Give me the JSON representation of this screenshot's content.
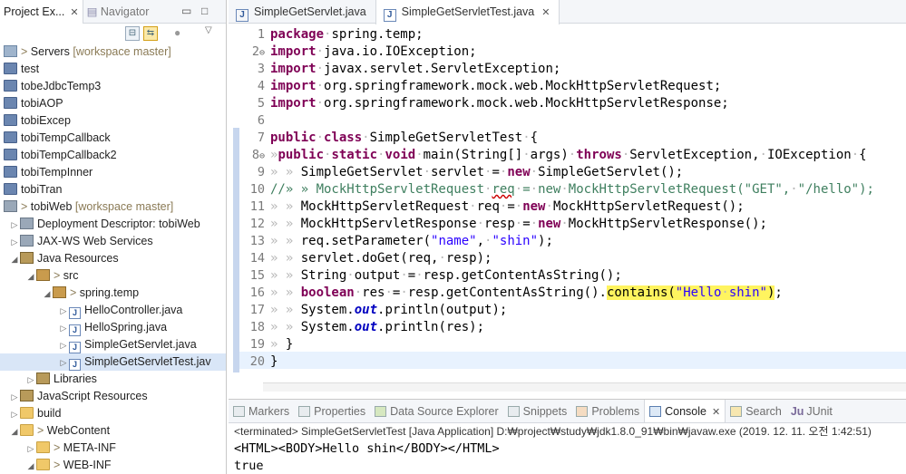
{
  "left_panel": {
    "tabs": [
      {
        "label": "Project Ex..."
      },
      {
        "label": "Navigator"
      }
    ],
    "tree": [
      {
        "label": "Servers",
        "suffix": "[workspace master]"
      },
      {
        "label": "test"
      },
      {
        "label": "tobeJdbcTemp3"
      },
      {
        "label": "tobiAOP"
      },
      {
        "label": "tobiExcep"
      },
      {
        "label": "tobiTempCallback"
      },
      {
        "label": "tobiTempCallback2"
      },
      {
        "label": "tobiTempInner"
      },
      {
        "label": "tobiTran"
      },
      {
        "label": "tobiWeb",
        "suffix": "[workspace master]"
      },
      {
        "label": "Deployment Descriptor: tobiWeb"
      },
      {
        "label": "JAX-WS Web Services"
      },
      {
        "label": "Java Resources"
      },
      {
        "label": "src"
      },
      {
        "label": "spring.temp"
      },
      {
        "label": "HelloController.java"
      },
      {
        "label": "HelloSpring.java"
      },
      {
        "label": "SimpleGetServlet.java"
      },
      {
        "label": "SimpleGetServletTest.jav"
      },
      {
        "label": "Libraries"
      },
      {
        "label": "JavaScript Resources"
      },
      {
        "label": "build"
      },
      {
        "label": "WebContent"
      },
      {
        "label": "META-INF"
      },
      {
        "label": "WEB-INF"
      }
    ]
  },
  "editor": {
    "tabs": [
      {
        "label": "SimpleGetServlet.java"
      },
      {
        "label": "SimpleGetServletTest.java"
      }
    ],
    "lines": [
      {
        "n": "1",
        "code": "package spring.temp;"
      },
      {
        "n": "2",
        "code": "import java.io.IOException;"
      },
      {
        "n": "3",
        "code": "import javax.servlet.ServletException;"
      },
      {
        "n": "4",
        "code": "import org.springframework.mock.web.MockHttpServletRequest;"
      },
      {
        "n": "5",
        "code": "import org.springframework.mock.web.MockHttpServletResponse;"
      },
      {
        "n": "6",
        "code": ""
      },
      {
        "n": "7",
        "code": "public class SimpleGetServletTest {"
      },
      {
        "n": "8",
        "code": "public static void main(String[] args) throws ServletException, IOException {"
      },
      {
        "n": "9",
        "code": "SimpleGetServlet servlet = new SimpleGetServlet();"
      },
      {
        "n": "10",
        "code": "MockHttpServletRequest req = new MockHttpServletRequest(\"GET\", \"/hello\");"
      },
      {
        "n": "11",
        "code": "MockHttpServletRequest req = new MockHttpServletRequest();"
      },
      {
        "n": "12",
        "code": "MockHttpServletResponse resp = new MockHttpServletResponse();"
      },
      {
        "n": "13",
        "code": "req.setParameter(\"name\", \"shin\");"
      },
      {
        "n": "14",
        "code": "servlet.doGet(req, resp);"
      },
      {
        "n": "15",
        "code": "String output = resp.getContentAsString();"
      },
      {
        "n": "16",
        "code": "boolean res = resp.getContentAsString().contains(\"Hello shin\");"
      },
      {
        "n": "17",
        "code": "System.out.println(output);"
      },
      {
        "n": "18",
        "code": "System.out.println(res);"
      },
      {
        "n": "19",
        "code": "}"
      },
      {
        "n": "20",
        "code": "}"
      }
    ]
  },
  "bottom_panel": {
    "tabs": [
      {
        "label": "Markers"
      },
      {
        "label": "Properties"
      },
      {
        "label": "Data Source Explorer"
      },
      {
        "label": "Snippets"
      },
      {
        "label": "Problems"
      },
      {
        "label": "Console"
      },
      {
        "label": "Search"
      },
      {
        "label": "JUnit"
      }
    ],
    "terminated": "<terminated> SimpleGetServletTest [Java Application] D:₩project₩study₩jdk1.8.0_91₩bin₩javaw.exe (2019. 12. 11. 오전 1:42:51)",
    "output": [
      "<HTML><BODY>Hello shin</BODY></HTML>",
      "true"
    ]
  },
  "colors": {
    "keyword": "#7f0055",
    "string": "#2a00ff",
    "comment": "#3f7f5f",
    "highlight": "#fff45f",
    "static_field": "#0000c0"
  },
  "icons": {
    "project": "project-icon",
    "folder": "folder-icon",
    "java_file": "java-file-icon",
    "package": "package-icon",
    "console": "console-icon"
  }
}
